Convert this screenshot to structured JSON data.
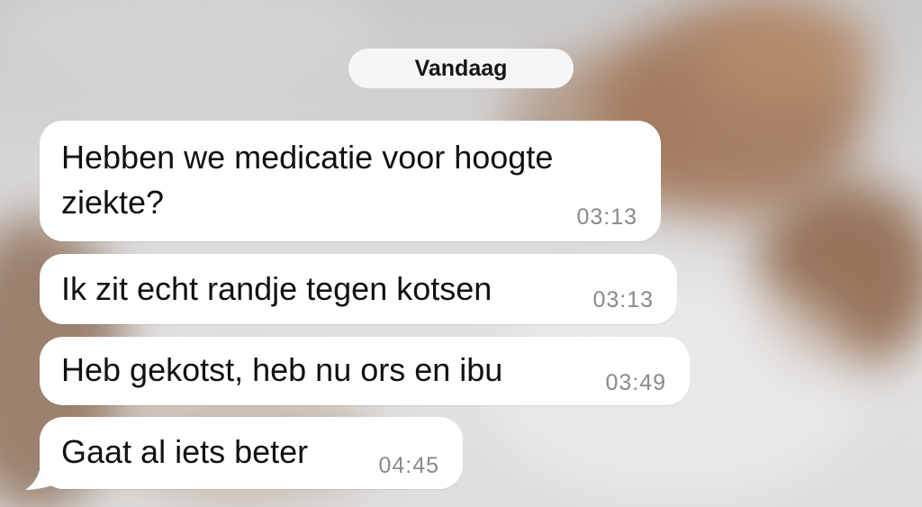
{
  "conversation": {
    "date_separator": "Vandaag",
    "messages": [
      {
        "text_line1": "Hebben we medicatie voor hoogte",
        "text_line2": "ziekte?",
        "time": "03:13"
      },
      {
        "text": "Ik zit echt randje tegen kotsen",
        "time": "03:13"
      },
      {
        "text": "Heb gekotst, heb nu ors en ibu",
        "time": "03:49"
      },
      {
        "text": "Gaat al iets beter",
        "time": "04:45"
      }
    ]
  },
  "colors": {
    "bubble": "#ffffff",
    "date_pill": "#f6f6f6",
    "message_text": "#111111",
    "timestamp_text": "#8a8a8a"
  }
}
